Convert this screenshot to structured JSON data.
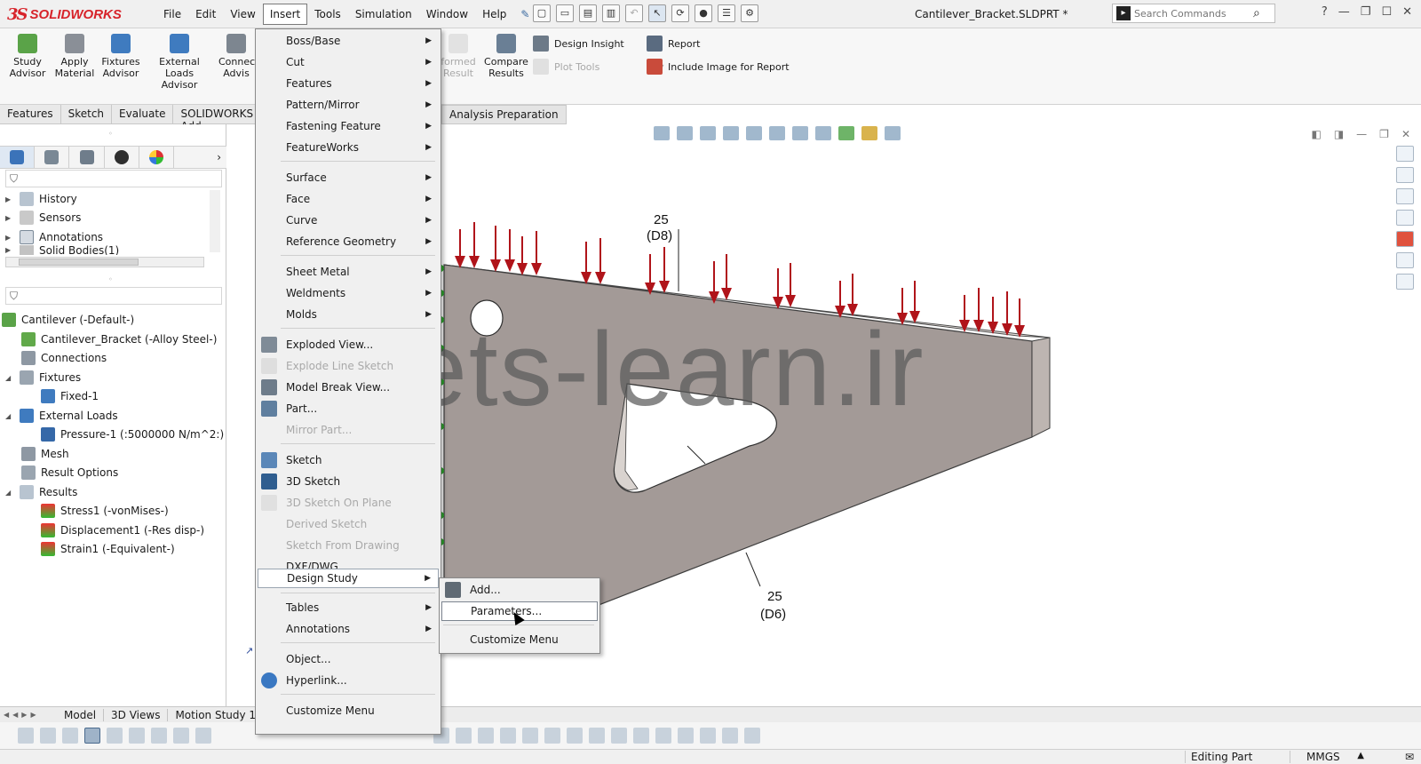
{
  "app": {
    "logo_mark": "3S",
    "logo_text": "SOLIDWORKS",
    "document_title": "Cantilever_Bracket.SLDPRT *"
  },
  "menubar": {
    "items": [
      "File",
      "Edit",
      "View",
      "Insert",
      "Tools",
      "Simulation",
      "Window",
      "Help"
    ],
    "open_menu": "Insert"
  },
  "search": {
    "placeholder": "Search Commands"
  },
  "ribbon": {
    "buttons": [
      {
        "label_1": "Study",
        "label_2": "Advisor"
      },
      {
        "label_1": "Apply",
        "label_2": "Material"
      },
      {
        "label_1": "Fixtures",
        "label_2": "Advisor"
      },
      {
        "label_1": "External Loads",
        "label_2": "Advisor"
      },
      {
        "label_1": "Connec",
        "label_2": "Advis"
      },
      {
        "label_1": "formed",
        "label_2": "Result"
      },
      {
        "label_1": "Compare",
        "label_2": "Results"
      }
    ],
    "design_insight": "Design Insight",
    "plot_tools": "Plot Tools",
    "report": "Report",
    "include_image": "Include Image for Report"
  },
  "command_tabs": {
    "tabs": [
      "Features",
      "Sketch",
      "Evaluate",
      "SOLIDWORKS Add-"
    ],
    "analysis_preparation": "Analysis Preparation"
  },
  "left_panel": {
    "feature_tree": [
      {
        "label": "History"
      },
      {
        "label": "Sensors"
      },
      {
        "label": "Annotations"
      },
      {
        "label": "Solid Bodies(1)"
      }
    ],
    "sim_tree": [
      {
        "label": "Cantilever (-Default-)"
      },
      {
        "label": "Cantilever_Bracket (-Alloy Steel-)"
      },
      {
        "label": "Connections"
      },
      {
        "label": "Fixtures"
      },
      {
        "label": "Fixed-1"
      },
      {
        "label": "External Loads"
      },
      {
        "label": "Pressure-1 (:5000000 N/m^2:)"
      },
      {
        "label": "Mesh"
      },
      {
        "label": "Result Options"
      },
      {
        "label": "Results"
      },
      {
        "label": "Stress1 (-vonMises-)"
      },
      {
        "label": "Displacement1 (-Res disp-)"
      },
      {
        "label": "Strain1 (-Equivalent-)"
      }
    ]
  },
  "insert_menu": {
    "items": [
      {
        "label": "Boss/Base",
        "submenu": true,
        "disabled": false
      },
      {
        "label": "Cut",
        "submenu": true,
        "disabled": false
      },
      {
        "label": "Features",
        "submenu": true,
        "disabled": false
      },
      {
        "label": "Pattern/Mirror",
        "submenu": true,
        "disabled": false
      },
      {
        "label": "Fastening Feature",
        "submenu": true,
        "disabled": false
      },
      {
        "label": "FeatureWorks",
        "submenu": true,
        "disabled": false
      },
      {
        "label": "Surface",
        "submenu": true,
        "disabled": false
      },
      {
        "label": "Face",
        "submenu": true,
        "disabled": false
      },
      {
        "label": "Curve",
        "submenu": true,
        "disabled": false
      },
      {
        "label": "Reference Geometry",
        "submenu": true,
        "disabled": false
      },
      {
        "label": "Sheet Metal",
        "submenu": true,
        "disabled": false
      },
      {
        "label": "Weldments",
        "submenu": true,
        "disabled": false
      },
      {
        "label": "Molds",
        "submenu": true,
        "disabled": false
      },
      {
        "label": "Exploded View...",
        "submenu": false,
        "disabled": false
      },
      {
        "label": "Explode Line Sketch",
        "submenu": false,
        "disabled": true
      },
      {
        "label": "Model Break View...",
        "submenu": false,
        "disabled": false
      },
      {
        "label": "Part...",
        "submenu": false,
        "disabled": false
      },
      {
        "label": "Mirror Part...",
        "submenu": false,
        "disabled": true
      },
      {
        "label": "Sketch",
        "submenu": false,
        "disabled": false
      },
      {
        "label": "3D Sketch",
        "submenu": false,
        "disabled": false
      },
      {
        "label": "3D Sketch On Plane",
        "submenu": false,
        "disabled": true
      },
      {
        "label": "Derived Sketch",
        "submenu": false,
        "disabled": true
      },
      {
        "label": "Sketch From Drawing",
        "submenu": false,
        "disabled": true
      },
      {
        "label": "DXF/DWG...",
        "submenu": false,
        "disabled": false
      },
      {
        "label": "Design Study",
        "submenu": true,
        "disabled": false,
        "highlighted": true
      },
      {
        "label": "Tables",
        "submenu": true,
        "disabled": false
      },
      {
        "label": "Annotations",
        "submenu": true,
        "disabled": false
      },
      {
        "label": "Object...",
        "submenu": false,
        "disabled": false
      },
      {
        "label": "Hyperlink...",
        "submenu": false,
        "disabled": false
      },
      {
        "label": "Customize Menu",
        "submenu": false,
        "disabled": false
      }
    ]
  },
  "design_study_submenu": {
    "items": [
      {
        "label": "Add..."
      },
      {
        "label": "Parameters...",
        "highlighted": true
      },
      {
        "label": "Customize Menu"
      }
    ]
  },
  "graphics": {
    "watermark": "lets-learn.ir",
    "dim_top_value": "25",
    "dim_top_name": "(D8)",
    "dim_bottom_value": "25",
    "dim_bottom_name": "(D6)"
  },
  "bottom_tabs": {
    "tabs": [
      "Model",
      "3D Views",
      "Motion Study 1"
    ]
  },
  "status": {
    "mode": "Editing Part",
    "units": "MMGS"
  },
  "colors": {
    "brand_red": "#d7232a",
    "load_arrow": "#b0141a",
    "part_gray": "#a39a97",
    "fixture_green": "#2fa52f"
  }
}
